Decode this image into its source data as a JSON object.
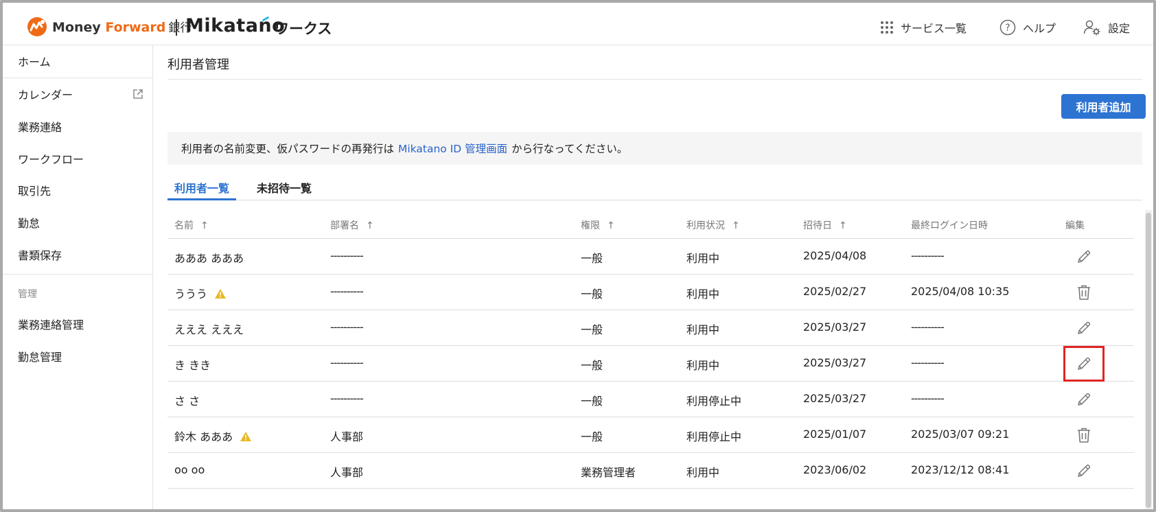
{
  "header": {
    "brand_money": "Money ",
    "brand_forward": "Forward",
    "brand_bank": "銀行",
    "brand_mikatano": "Mikatano",
    "brand_works": "ワークス",
    "nav": {
      "services": "サービス一覧",
      "help": "ヘルプ",
      "settings": "設定"
    }
  },
  "sidebar": {
    "items": [
      {
        "label": "ホーム"
      },
      {
        "label": "カレンダー"
      },
      {
        "label": "業務連絡"
      },
      {
        "label": "ワークフロー"
      },
      {
        "label": "取引先"
      },
      {
        "label": "勤怠"
      },
      {
        "label": "書類保存"
      }
    ],
    "admin_section": "管理",
    "admin_items": [
      {
        "label": "業務連絡管理"
      },
      {
        "label": "勤怠管理"
      }
    ]
  },
  "main": {
    "title": "利用者管理",
    "add_button": "利用者追加",
    "notice_before": "利用者の名前変更、仮パスワードの再発行は",
    "notice_link": "Mikatano ID 管理画面",
    "notice_after": "から行なってください。",
    "tabs": [
      {
        "label": "利用者一覧",
        "active": true
      },
      {
        "label": "未招待一覧",
        "active": false
      }
    ],
    "columns": {
      "name": "名前",
      "department": "部署名",
      "role": "権限",
      "status": "利用状況",
      "invited": "招待日",
      "last_login": "最終ログイン日時",
      "edit": "編集"
    },
    "sort_arrow": "↑",
    "rows": [
      {
        "name": "あああ あああ",
        "department": "----------",
        "role": "一般",
        "status": "利用中",
        "invited": "2025/04/08",
        "last_login": "----------",
        "action": "edit",
        "warning": false
      },
      {
        "name": "ううう",
        "department": "----------",
        "role": "一般",
        "status": "利用中",
        "invited": "2025/02/27",
        "last_login": "2025/04/08 10:35",
        "action": "delete",
        "warning": true
      },
      {
        "name": "えええ えええ",
        "department": "----------",
        "role": "一般",
        "status": "利用中",
        "invited": "2025/03/27",
        "last_login": "----------",
        "action": "edit",
        "warning": false
      },
      {
        "name": "き きき",
        "department": "----------",
        "role": "一般",
        "status": "利用中",
        "invited": "2025/03/27",
        "last_login": "----------",
        "action": "edit",
        "warning": false
      },
      {
        "name": "さ さ",
        "department": "----------",
        "role": "一般",
        "status": "利用停止中",
        "invited": "2025/03/27",
        "last_login": "----------",
        "action": "edit",
        "warning": false
      },
      {
        "name": "鈴木 あああ",
        "department": "人事部",
        "role": "一般",
        "status": "利用停止中",
        "invited": "2025/01/07",
        "last_login": "2025/03/07 09:21",
        "action": "delete",
        "warning": true
      },
      {
        "name": "oo oo",
        "department": "人事部",
        "role": "業務管理者",
        "status": "利用中",
        "invited": "2023/06/02",
        "last_login": "2023/12/12 08:41",
        "action": "edit",
        "warning": false
      }
    ]
  },
  "colors": {
    "accent": "#2c73d2",
    "brand_orange": "#f06a16",
    "warning": "#e8b923",
    "highlight": "#e02424"
  },
  "icons": {
    "services": "grid-dots-icon",
    "help": "question-circle-icon",
    "settings": "user-gear-icon",
    "calendar_external": "external-link-icon",
    "edit": "pencil-icon",
    "delete": "trash-icon",
    "warning": "warning-triangle-icon"
  }
}
